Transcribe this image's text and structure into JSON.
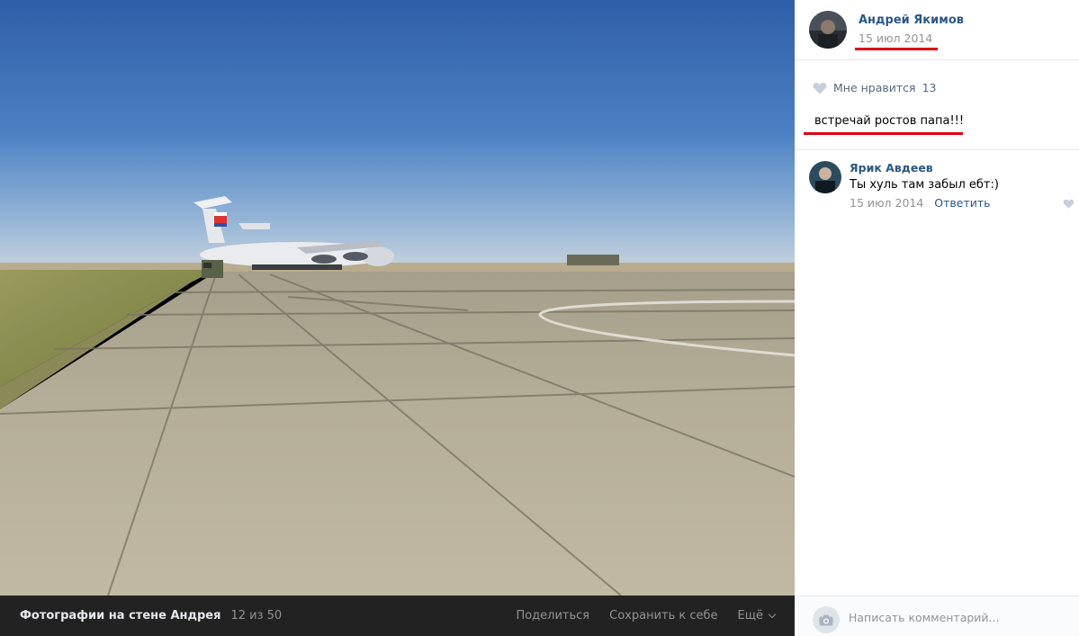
{
  "photo": {
    "subject": "Transport aircraft parked on a concrete airfield under a blue sky"
  },
  "photo_bar": {
    "album_title": "Фотографии на стене Андрея",
    "counter": "12 из 50",
    "share_label": "Поделиться",
    "save_label": "Сохранить к себе",
    "more_label": "Ещё"
  },
  "post": {
    "author_name": "Андрей Якимов",
    "date": "15 июл 2014",
    "likes_label": "Мне нравится",
    "likes_count": "13",
    "caption": "встречай ростов папа!!!"
  },
  "comments": [
    {
      "author": "Ярик Авдеев",
      "text": "Ты хуль там забыл ебт:)",
      "date": "15 июл 2014",
      "reply_label": "Ответить"
    }
  ],
  "comment_box": {
    "placeholder": "Написать комментарий..."
  },
  "colors": {
    "link": "#2a5885",
    "muted": "#939393",
    "highlight": "#e10012",
    "dark_bar": "#222222"
  },
  "icons": [
    "heart-icon",
    "chevron-down-icon",
    "camera-icon"
  ]
}
